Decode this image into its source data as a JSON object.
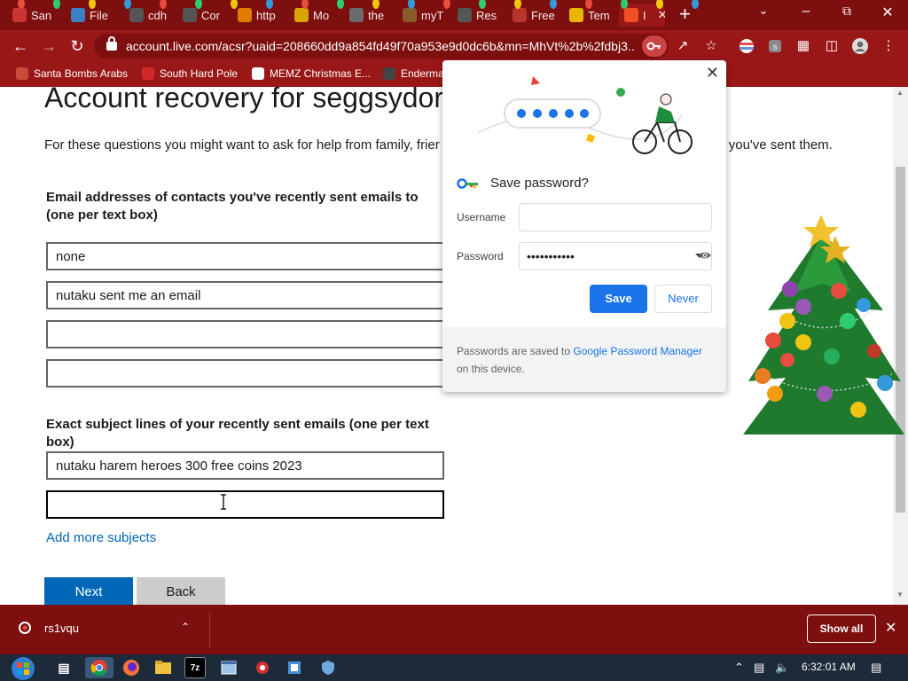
{
  "browser": {
    "tabs": [
      {
        "label": "San",
        "color": "#cc3333",
        "glyph": ""
      },
      {
        "label": "File",
        "color": "#3b82c4",
        "glyph": ""
      },
      {
        "label": "cdh",
        "color": "#555555",
        "glyph": ""
      },
      {
        "label": "Cor",
        "color": "#555555",
        "glyph": ""
      },
      {
        "label": "http",
        "color": "#e07b00",
        "glyph": ""
      },
      {
        "label": "Mo",
        "color": "#d9a300",
        "glyph": ""
      },
      {
        "label": "the",
        "color": "#6b6b6b",
        "glyph": ""
      },
      {
        "label": "myT",
        "color": "#8a5a2b",
        "glyph": ""
      },
      {
        "label": "Res",
        "color": "#555555",
        "glyph": ""
      },
      {
        "label": "Free",
        "color": "#b8342c",
        "glyph": ""
      },
      {
        "label": "Tem",
        "color": "#e8b600",
        "glyph": ""
      },
      {
        "label": "I",
        "color": "#f25022",
        "glyph": ""
      }
    ],
    "url": "account.live.com/acsr?uaid=208660dd9a854fd49f70a953e9d0dc6b&mn=MhVt%2b%2fdbj3...",
    "bookmarks": [
      {
        "label": "Santa Bombs Arabs",
        "color": "#c94a3a"
      },
      {
        "label": "South Hard Pole",
        "color": "#d22a2a"
      },
      {
        "label": "MEMZ Christmas E...",
        "color": "#ffffff"
      },
      {
        "label": "Enderma",
        "color": "#444444"
      }
    ]
  },
  "page": {
    "heading": "Account recovery for seggsydor",
    "intro": "For these questions you might want to ask for help from family, frier                                                              ddresses and tell you the subject lines of emails you've sent them.",
    "contacts_label": "Email addresses of contacts you've recently sent emails to (one per text box)",
    "contacts": [
      "none",
      "nutaku sent me an email",
      "",
      ""
    ],
    "subjects_label": "Exact subject lines of your recently sent emails (one per text box)",
    "subjects": [
      "nutaku harem heroes 300 free coins 2023",
      ""
    ],
    "add_more": "Add more subjects",
    "next_label": "Next",
    "back_label": "Back"
  },
  "popup": {
    "title": "Save password?",
    "username_label": "Username",
    "username_value": "",
    "password_label": "Password",
    "password_value": "•••••••••••",
    "save_label": "Save",
    "never_label": "Never",
    "footer_pre": "Passwords are saved to ",
    "footer_link": "Google Password Manager",
    "footer_post": " on this device."
  },
  "download": {
    "filename": "rs1vqu",
    "show_all": "Show all"
  },
  "taskbar": {
    "clock": "6:32:01 AM"
  },
  "colors": {
    "chrome_dark": "#7d0f0f",
    "chrome": "#9a1717",
    "ms_blue": "#0067b8",
    "google_blue": "#1a73e8"
  }
}
